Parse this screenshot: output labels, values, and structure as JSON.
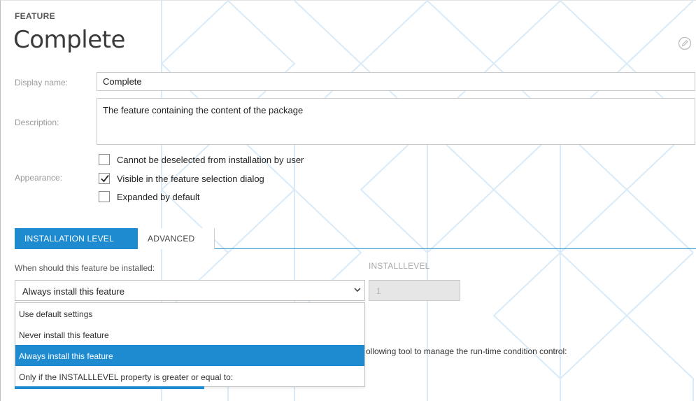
{
  "header": {
    "section_label": "FEATURE",
    "title": "Complete",
    "edit_icon": "pencil-circle-icon"
  },
  "form": {
    "display_name_label": "Display name:",
    "display_name_value": "Complete",
    "description_label": "Description:",
    "description_value": "The feature containing the content of the package",
    "appearance_label": "Appearance:",
    "options": [
      {
        "label": "Cannot be deselected from installation by user",
        "checked": false
      },
      {
        "label": "Visible in the feature selection dialog",
        "checked": true
      },
      {
        "label": "Expanded by default",
        "checked": false
      }
    ]
  },
  "tabs": [
    {
      "label": "INSTALLATION LEVEL",
      "active": true
    },
    {
      "label": "ADVANCED",
      "active": false
    }
  ],
  "installation": {
    "question": "When should this feature be installed:",
    "selected": "Always install this feature",
    "arrow_icon": "chevron-down-icon",
    "installlevel_label": "INSTALLLEVEL",
    "installlevel_value": "1",
    "dropdown_options": [
      "Use default settings",
      "Never install this feature",
      "Always install this feature",
      "Only if the INSTALLLEVEL property is greater or equal to:"
    ],
    "selected_index": 2,
    "tool_text": "ollowing tool to manage the run-time condition control:"
  },
  "colors": {
    "accent": "#1e8bd0",
    "background_lines": "#dcecf8"
  }
}
